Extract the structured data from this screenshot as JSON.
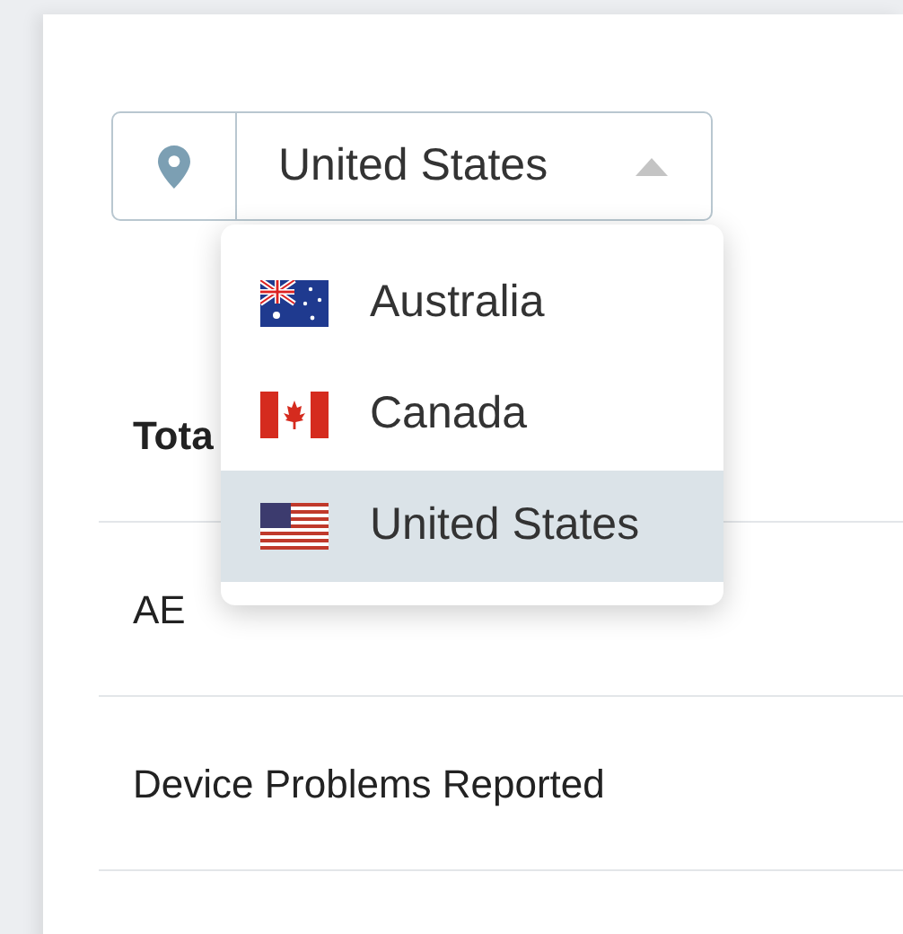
{
  "location_select": {
    "value": "United States",
    "expanded": true,
    "options": [
      {
        "label": "Australia",
        "kind": "au",
        "selected": false
      },
      {
        "label": "Canada",
        "kind": "ca",
        "selected": false
      },
      {
        "label": "United States",
        "kind": "us",
        "selected": true
      }
    ]
  },
  "rows": [
    {
      "label": "Tota",
      "kind": "heading"
    },
    {
      "label": "AE",
      "kind": "item"
    },
    {
      "label": "Device Problems Reported",
      "kind": "item"
    }
  ]
}
